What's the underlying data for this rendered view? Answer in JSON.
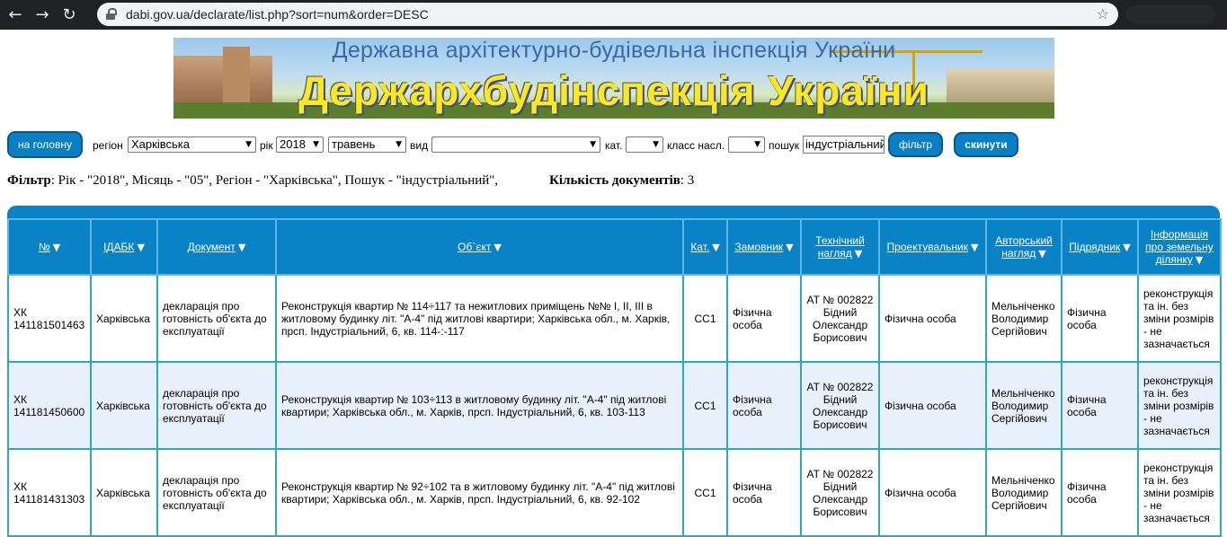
{
  "browser": {
    "url": "dabi.gov.ua/declarate/list.php?sort=num&order=DESC"
  },
  "banner": {
    "subtitle": "Державна архітектурно-будівельна інспекція України",
    "title": "Держархбудінспекція України"
  },
  "filters": {
    "home_label": "на головну",
    "region_label": "регіон",
    "region_value": "Харківська",
    "year_label": "рік",
    "year_value": "2018",
    "month_value": "травень",
    "type_label": "вид",
    "type_value": "",
    "cat_label": "кат.",
    "cat_value": "",
    "class_label": "класс насл.",
    "class_value": "",
    "search_label": "пошук",
    "search_value": "індустріальний",
    "filter_button": "фільтр",
    "reset_button": "скинути"
  },
  "summary": {
    "filter_label": "Фільтр",
    "filter_text": ": Рік - \"2018\", Місяць - \"05\", Регіон - \"Харківська\", Пошук - \"індустріальний\",",
    "count_label": "Кількість документів",
    "count_value": ": 3"
  },
  "table": {
    "headers": [
      "№",
      "ІДАБК",
      "Документ",
      "Об`єкт",
      "Кат.",
      "Замовник",
      "Технічний нагляд",
      "Проектувальник",
      "Авторський нагляд",
      "Підрядник",
      "Інформація про земельну ділянку"
    ],
    "rows": [
      {
        "num": "ХК 141181501463",
        "idabk": "Харківська",
        "doc": "декларація про готовність об'єкта до експлуатації",
        "object": "Реконструкція квартир № 114÷117 та нежитлових приміщень №№ І, ІІ, ІІІ в житловому будинку літ. \"А-4\" під житлові квартири; Харківська обл., м. Харків, прсп. Індустріальний, 6, кв. 114-:-117",
        "cat": "СС1",
        "customer": "Фізична особа",
        "tech": "АТ № 002822 Бідний Олександр Борисович",
        "designer": "Фізична особа",
        "author": "Мельніченко Володимир Сергійович",
        "contractor": "Фізична особа",
        "land": "реконструкція та ін. без зміни розмірів - не зазначається"
      },
      {
        "num": "ХК 141181450600",
        "idabk": "Харківська",
        "doc": "декларація про готовність об'єкта до експлуатації",
        "object": "Реконструкція квартир № 103÷113 в житловому будинку літ. \"А-4\" під житлові квартири; Харківська обл., м. Харків, прсп. Індустріальний, 6, кв. 103-113",
        "cat": "СС1",
        "customer": "Фізична особа",
        "tech": "АТ № 002822 Бідний Олександр Борисович",
        "designer": "Фізична особа",
        "author": "Мельніченко Володимир Сергійович",
        "contractor": "Фізична особа",
        "land": "реконструкція та ін. без зміни розмірів - не зазначається"
      },
      {
        "num": "ХК 141181431303",
        "idabk": "Харківська",
        "doc": "декларація про готовність об'єкта до експлуатації",
        "object": "Реконструкція квартир № 92÷102 та в житловому будинку літ. \"А-4\" під житлові квартири; Харківська обл., м. Харків, прсп. Індустріальний, 6, кв. 92-102",
        "cat": "СС1",
        "customer": "Фізична особа",
        "tech": "АТ № 002822 Бідний Олександр Борисович",
        "designer": "Фізична особа",
        "author": "Мельніченко Володимир Сергійович",
        "contractor": "Фізична особа",
        "land": "реконструкція та ін. без зміни розмірів - не зазначається"
      }
    ]
  }
}
